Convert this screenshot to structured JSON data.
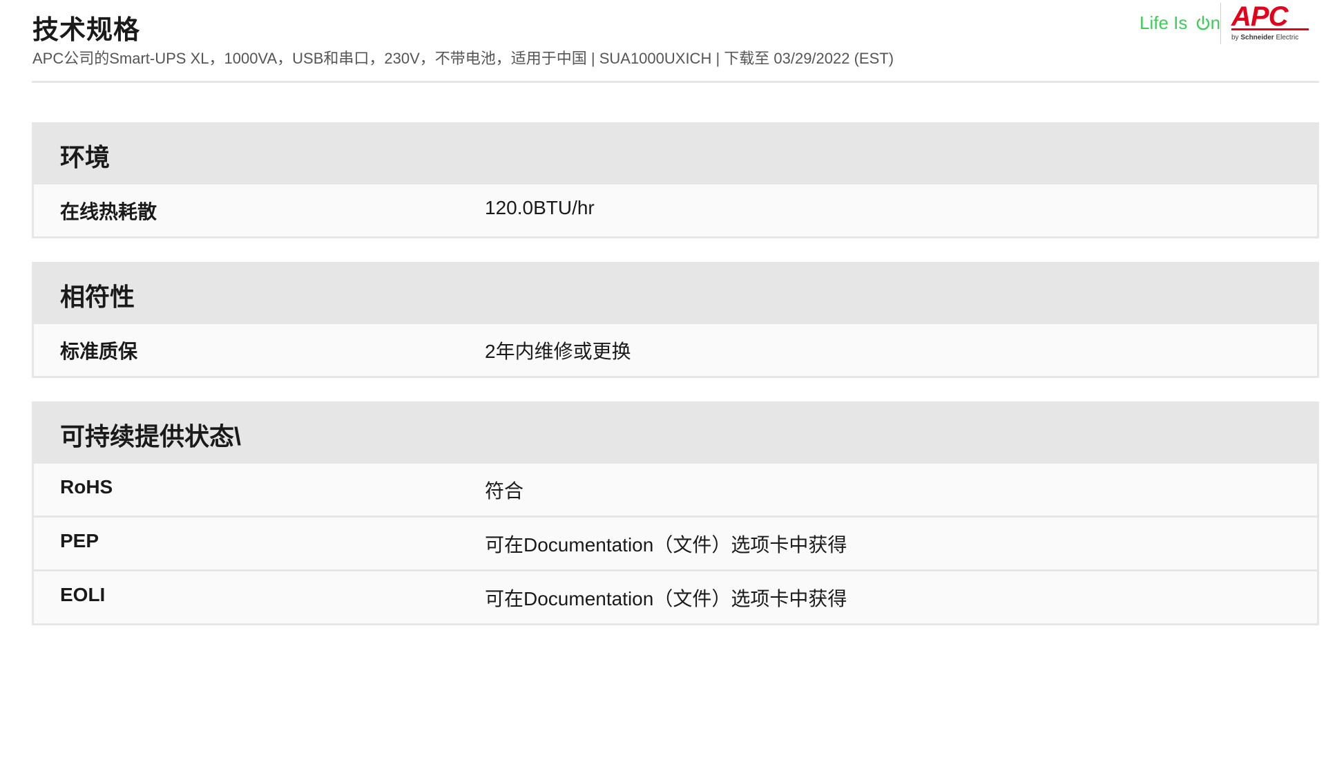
{
  "header": {
    "title": "技术规格",
    "subtitle": "APC公司的Smart-UPS XL，1000VA，USB和串口，230V，不带电池，适用于中国 | SUA1000UXICH | 下载至 03/29/2022 (EST)"
  },
  "brand": {
    "tagline_prefix": "Life Is ",
    "tagline_suffix": "n",
    "tagline_icon": "power-icon",
    "logo_text": "APC",
    "logo_byline_prefix": "by ",
    "logo_byline_brand": "Schneider",
    "logo_byline_suffix": " Electric",
    "colors": {
      "tagline": "#3dcd58",
      "logo": "#e3001b"
    }
  },
  "sections": [
    {
      "title": "环境",
      "rows": [
        {
          "label": "在线热耗散",
          "value": "120.0BTU/hr"
        }
      ]
    },
    {
      "title": "相符性",
      "rows": [
        {
          "label": "标准质保",
          "value": "2年内维修或更换"
        }
      ]
    },
    {
      "title": "可持续提供状态\\",
      "rows": [
        {
          "label": "RoHS",
          "value": "符合"
        },
        {
          "label": "PEP",
          "value": "可在Documentation（文件）选项卡中获得"
        },
        {
          "label": "EOLI",
          "value": "可在Documentation（文件）选项卡中获得"
        }
      ]
    }
  ],
  "colors": {
    "section_header_bg": "#e6e6e6",
    "row_bg": "#fafafa",
    "border": "#e6e6e6"
  }
}
